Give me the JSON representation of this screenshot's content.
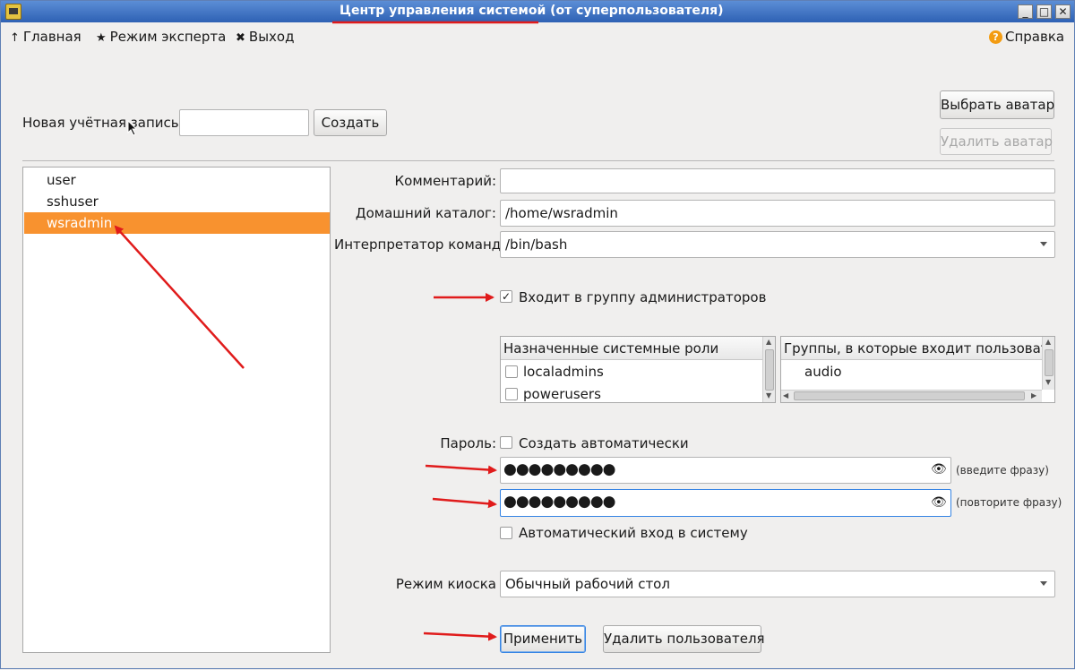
{
  "window": {
    "title": "Центр управления системой (от суперпользователя)",
    "buttons": {
      "minimize": "_",
      "maximize": "□",
      "close": "✕"
    }
  },
  "menu": {
    "home": {
      "icon": "up-arrow-icon",
      "glyph": "↑",
      "label": "Главная"
    },
    "expert": {
      "icon": "star-icon",
      "glyph": "★",
      "label": "Режим эксперта"
    },
    "exit": {
      "icon": "tools-icon",
      "glyph": "✖",
      "label": "Выход"
    },
    "help": {
      "icon": "help-icon",
      "glyph": "?",
      "label": "Справка"
    }
  },
  "new_account": {
    "label": "Новая учётная запись:",
    "value": "",
    "create_button": "Создать"
  },
  "avatar": {
    "choose_button": "Выбрать аватар",
    "delete_button": "Удалить аватар"
  },
  "users": [
    {
      "name": "user",
      "selected": false
    },
    {
      "name": "sshuser",
      "selected": false
    },
    {
      "name": "wsradmin",
      "selected": true
    }
  ],
  "form": {
    "comment": {
      "label": "Комментарий:",
      "value": ""
    },
    "home_dir": {
      "label": "Домашний каталог:",
      "value": "/home/wsradmin"
    },
    "shell": {
      "label": "Интерпретатор команд:",
      "value": "/bin/bash"
    },
    "admin_group": {
      "label": "Входит в группу администраторов",
      "checked": true,
      "check_glyph": "✓"
    },
    "roles": {
      "header": "Назначенные системные роли",
      "items": [
        {
          "name": "localadmins",
          "checked": false
        },
        {
          "name": "powerusers",
          "checked": false
        }
      ]
    },
    "groups": {
      "header": "Группы, в которые входит пользователь",
      "items": [
        "audio"
      ]
    },
    "password": {
      "label": "Пароль:",
      "auto_label": "Создать автоматически",
      "auto_checked": false,
      "value1": "●●●●●●●●●",
      "hint1": "(введите фразу)",
      "value2": "●●●●●●●●●",
      "hint2": "(повторите фразу)",
      "eye_glyph": "👁"
    },
    "autologin": {
      "label": "Автоматический вход в систему",
      "checked": false
    },
    "kiosk": {
      "label": "Режим киоска",
      "value": "Обычный рабочий стол"
    },
    "apply_button": "Применить",
    "delete_user_button": "Удалить пользователя"
  },
  "colors": {
    "selection": "#f8922f",
    "titlebar": "#2e61b4",
    "annotation": "#e01b1b",
    "focus": "#3584e4"
  }
}
